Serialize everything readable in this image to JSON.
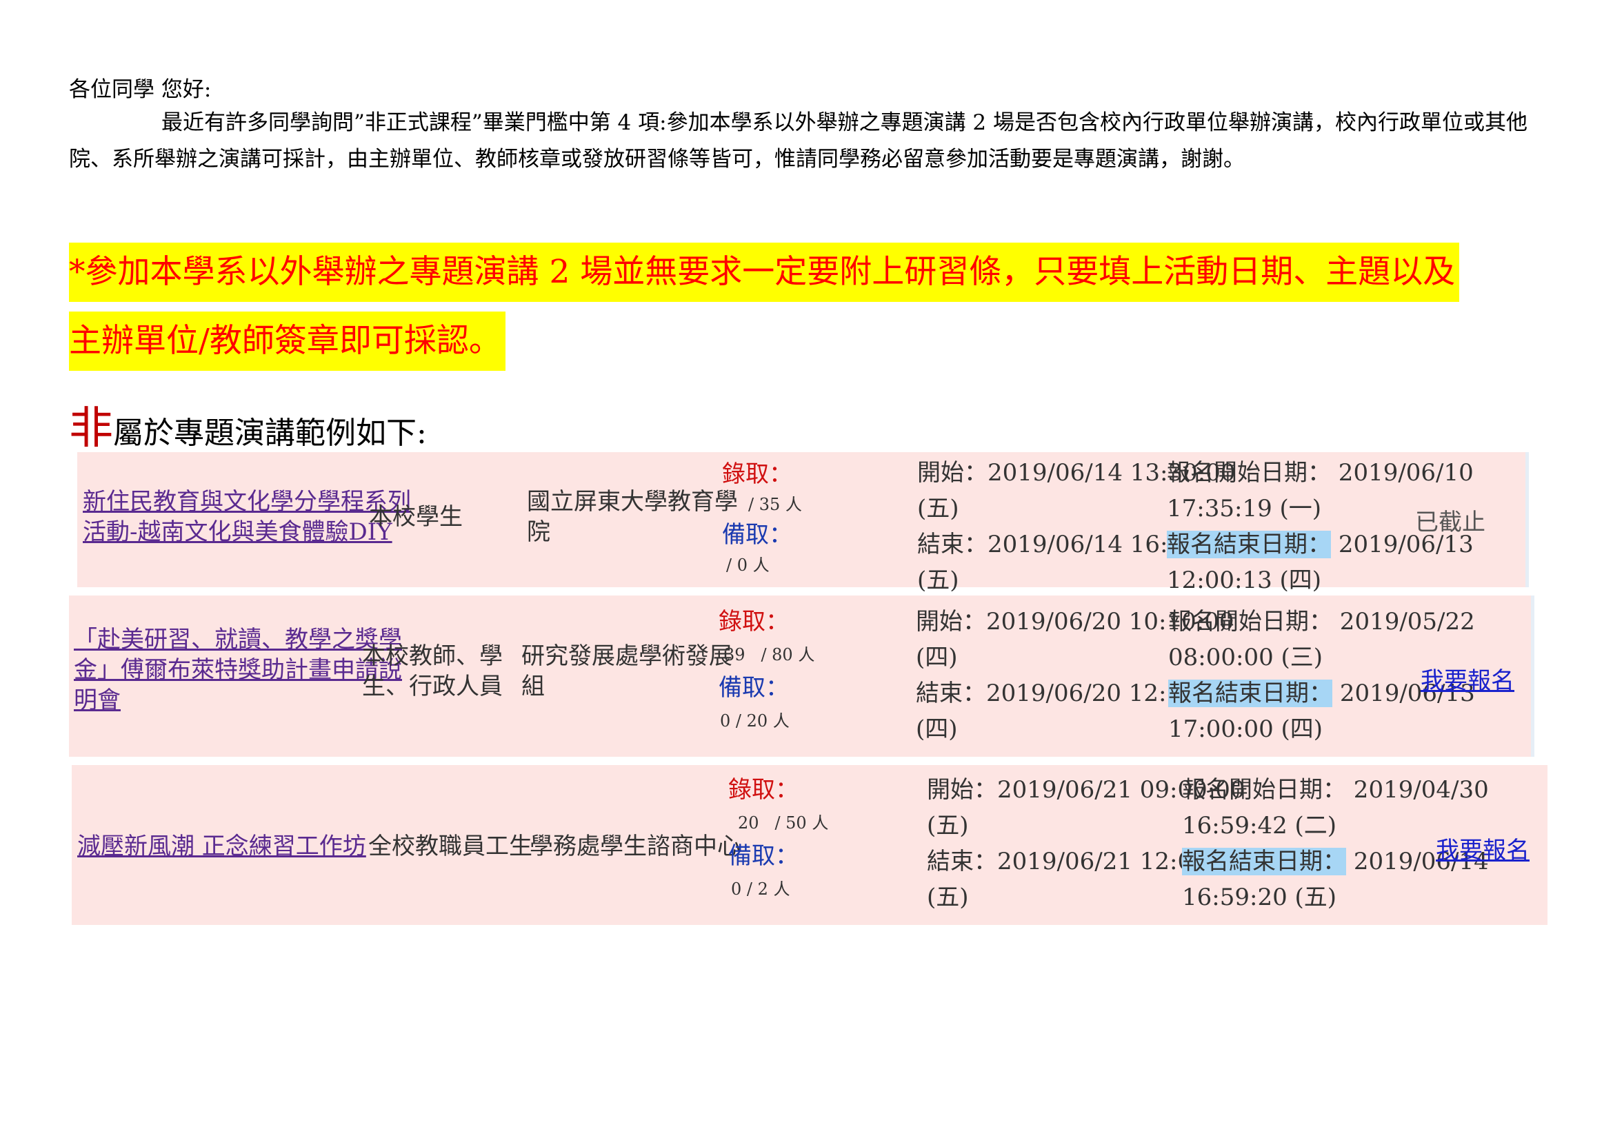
{
  "greeting": "各位同學  您好:",
  "paragraph": "最近有許多同學詢問”非正式課程”畢業門檻中第 4 項:參加本學系以外舉辦之專題演講 2 場是否包含校內行政單位舉辦演講，校內行政單位或其他院、系所舉辦之演講可採計，由主辦單位、教師核章或發放研習條等皆可，惟請同學務必留意參加活動要是專題演講，謝謝。",
  "highlight": {
    "line1": "*參加本學系以外舉辦之專題演講 2 場並無要求一定要附上研習條，只要填上活動日期、主題以及",
    "line2": "主辦單位/教師簽章即可採認。"
  },
  "example_heading": {
    "mark": "非",
    "rest": "屬於專題演講範例如下:"
  },
  "labels": {
    "admitted": "錄取：",
    "waitlist": "備取：",
    "reg_end": "報名結束日期："
  },
  "events": [
    {
      "title_line1": "新住民教育與文化學分學程系列",
      "title_line2": "活動-越南文化與美食體驗DIY",
      "audience_line1": "本校學生",
      "audience_line2": "",
      "organizer_line1": "國立屏東大學教育學",
      "organizer_line2": "院",
      "admitted_count": "",
      "admitted_quota": "/ 35 人",
      "waitlist_count": "",
      "waitlist_quota": "/ 0   人",
      "start": "開始：2019/06/14 13:30:00",
      "start_day": "(五)",
      "end": "結束：2019/06/14 16:30:00",
      "end_day": "(五)",
      "reg_start": "報名開始日期： 2019/06/10",
      "reg_start_2": "17:35:19 (一)",
      "reg_end": "2019/06/13",
      "reg_end_2": "12:00:13 (四)",
      "action": "已截止"
    },
    {
      "title_line1": "「赴美研習、就讀、教學之獎學",
      "title_line2": "金」傅爾布萊特獎助計畫申請說",
      "title_line3": "明會",
      "audience_line1": "本校教師、學",
      "audience_line2": "生、行政人員",
      "organizer_line1": "研究發展處學術發展",
      "organizer_line2": "組",
      "admitted_count": "39",
      "admitted_quota": "/ 80 人",
      "waitlist_count": "0",
      "waitlist_quota": "/ 20  人",
      "start": "開始：2019/06/20 10:10:00",
      "start_day": "(四)",
      "end": "結束：2019/06/20 12:30:00",
      "end_day": "(四)",
      "reg_start": "報名開始日期： 2019/05/22",
      "reg_start_2": "08:00:00 (三)",
      "reg_end": "2019/06/13",
      "reg_end_2": "17:00:00 (四)",
      "action": "我要報名"
    },
    {
      "title_line1": "減壓新風潮 正念練習工作坊",
      "audience_line1": "全校教職員工生",
      "organizer_line1": "學務處學生諮商中心",
      "admitted_count": "20",
      "admitted_quota": "/ 50 人",
      "waitlist_count": "0",
      "waitlist_quota": "/ 2  人",
      "start": "開始：2019/06/21 09:00:00",
      "start_day": "(五)",
      "end": "結束：2019/06/21 12:00:00",
      "end_day": "(五)",
      "reg_start": "報名開始日期： 2019/04/30",
      "reg_start_2": "16:59:42 (二)",
      "reg_end": "2019/06/14",
      "reg_end_2": "16:59:20 (五)",
      "action": "我要報名"
    }
  ]
}
